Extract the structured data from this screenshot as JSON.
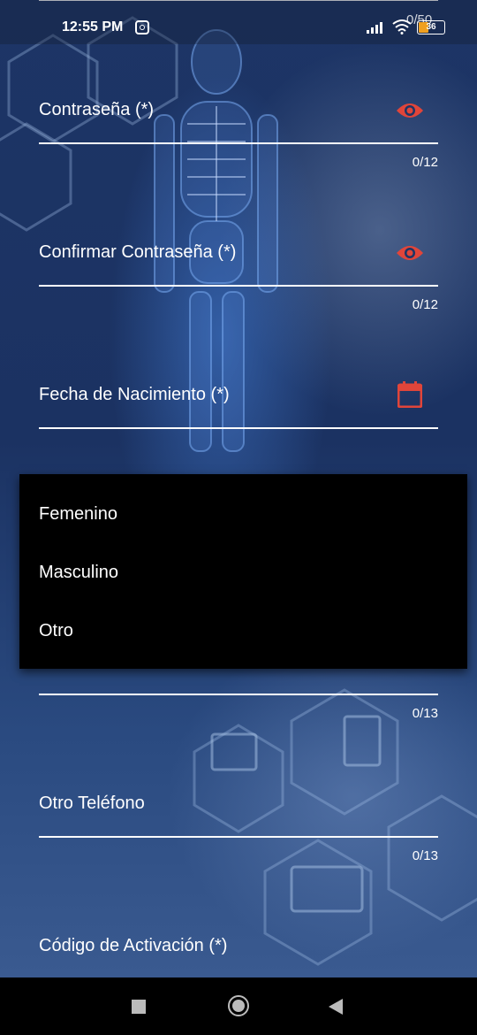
{
  "status_bar": {
    "time": "12:55 PM",
    "battery": "36",
    "overlay_counter": "0/50",
    "icons": [
      "instagram-icon",
      "signal-icon",
      "wifi-icon",
      "battery-icon"
    ]
  },
  "form": {
    "password": {
      "label": "Contraseña (*)",
      "counter": "0/12",
      "icon": "eye-icon"
    },
    "confirm_password": {
      "label": "Confirmar Contraseña (*)",
      "counter": "0/12",
      "icon": "eye-icon"
    },
    "birth_date": {
      "label": "Fecha de Nacimiento (*)",
      "icon": "calendar-icon"
    },
    "phone": {
      "counter": "0/13"
    },
    "other_phone": {
      "label": "Otro Teléfono",
      "counter": "0/13"
    },
    "activation_code": {
      "label": "Código de Activación (*)"
    }
  },
  "dropdown": {
    "options": [
      "Femenino",
      "Masculino",
      "Otro"
    ]
  },
  "colors": {
    "accent": "#e0453a",
    "text": "#ffffff",
    "dropdown_bg": "#000000"
  },
  "nav_bar": {
    "icons": [
      "recents-icon",
      "home-icon",
      "back-icon"
    ]
  }
}
